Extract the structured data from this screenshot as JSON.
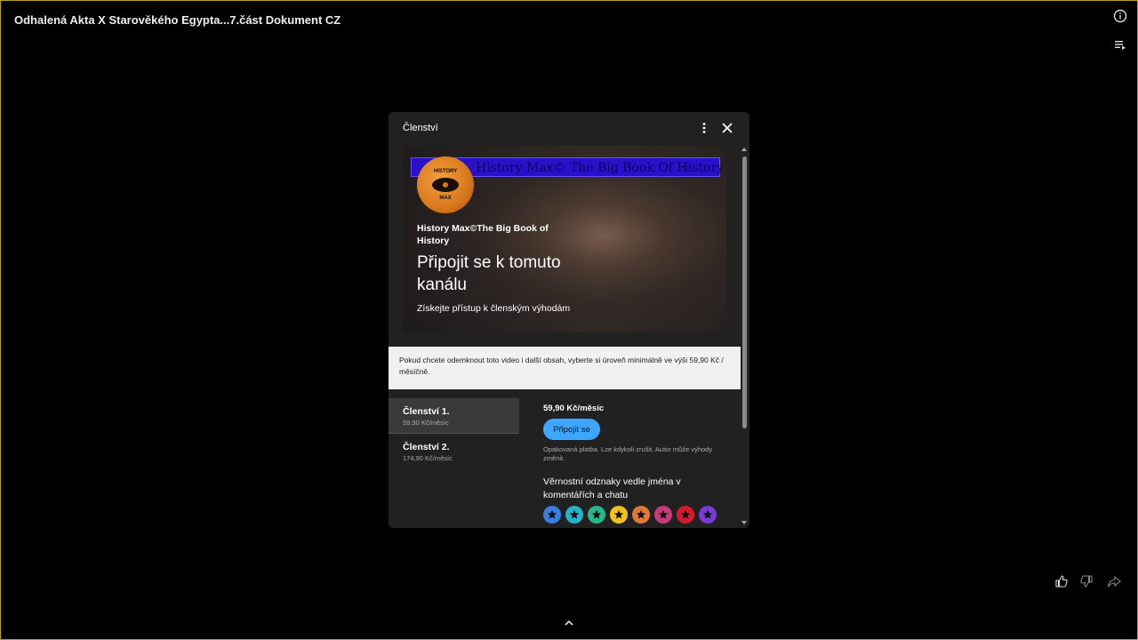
{
  "video": {
    "title": "Odhalená Akta X Starověkého Egypta...7.část Dokument CZ"
  },
  "membership_dialog": {
    "title": "Členství",
    "banner": {
      "strip_text": "History Max© The Big Book Of History",
      "logo_text_top": "HISTORY",
      "logo_text_bottom": "MAX",
      "channel_name": "History Max©The Big Book of History",
      "heading": "Připojit se k tomuto kanálu",
      "subheading": "Získejte přístup k členským výhodám"
    },
    "notice": "Pokud chcete odemknout toto video i další obsah, vyberte si úroveň minimálně ve výši 59,90 Kč / měsíčně.",
    "tiers": [
      {
        "name": "Členství 1.",
        "price": "59,90 Kč/měsíc"
      },
      {
        "name": "Členství 2.",
        "price": "174,90 Kč/měsíc"
      }
    ],
    "selected_tier": {
      "price": "59,90 Kč/měsíc",
      "join_label": "Připojit se",
      "fineprint": "Opakovaná platba. Lze kdykoli zrušit. Autor může výhody změnit.",
      "perk_title": "Věrnostní odznaky vedle jména v komentářích a chatu",
      "badge_colors": [
        "#3b7de0",
        "#26b3c9",
        "#2bb58a",
        "#f2c21b",
        "#e0783a",
        "#c93a7a",
        "#d61a2b",
        "#7a3ad6"
      ]
    }
  },
  "icons": {
    "info": "info-icon",
    "queue": "playlist-icon",
    "more": "more-vert-icon",
    "close": "close-icon",
    "like": "thumb-up-icon",
    "dislike": "thumb-down-icon",
    "share": "share-icon",
    "expand": "chevron-up-icon"
  }
}
